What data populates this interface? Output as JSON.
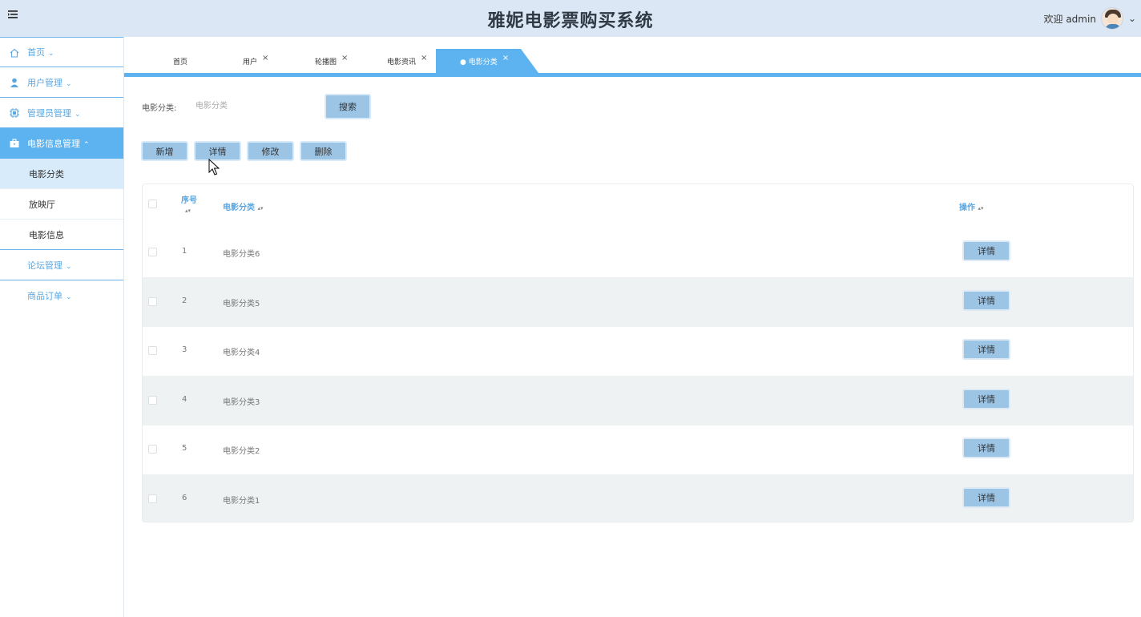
{
  "app": {
    "title": "雅妮电影票购买系统"
  },
  "header": {
    "welcome": "欢迎 admin"
  },
  "sidebar": {
    "items": [
      {
        "label": "首页",
        "icon": "home-icon"
      },
      {
        "label": "用户管理",
        "icon": "user-icon"
      },
      {
        "label": "管理员管理",
        "icon": "chip-icon"
      },
      {
        "label": "电影信息管理",
        "icon": "briefcase-icon"
      },
      {
        "label": "论坛管理"
      },
      {
        "label": "商品订单"
      }
    ],
    "subitems": [
      {
        "label": "电影分类"
      },
      {
        "label": "放映厅"
      },
      {
        "label": "电影信息"
      }
    ]
  },
  "tabs": [
    {
      "label": "首页"
    },
    {
      "label": "用户",
      "close": "×"
    },
    {
      "label": "轮播图",
      "close": "×"
    },
    {
      "label": "电影资讯",
      "close": "×"
    },
    {
      "label": "● 电影分类",
      "close": "×"
    }
  ],
  "search": {
    "label": "电影分类:",
    "placeholder": "电影分类",
    "button": "搜索"
  },
  "toolbar": {
    "add": "新增",
    "detail": "详情",
    "edit": "修改",
    "delete": "删除"
  },
  "table": {
    "headers": {
      "index": "序号",
      "category": "电影分类",
      "action": "操作"
    },
    "detail_label": "详情",
    "rows": [
      {
        "index": "1",
        "category": "电影分类6"
      },
      {
        "index": "2",
        "category": "电影分类5"
      },
      {
        "index": "3",
        "category": "电影分类4"
      },
      {
        "index": "4",
        "category": "电影分类3"
      },
      {
        "index": "5",
        "category": "电影分类2"
      },
      {
        "index": "6",
        "category": "电影分类1"
      }
    ]
  }
}
